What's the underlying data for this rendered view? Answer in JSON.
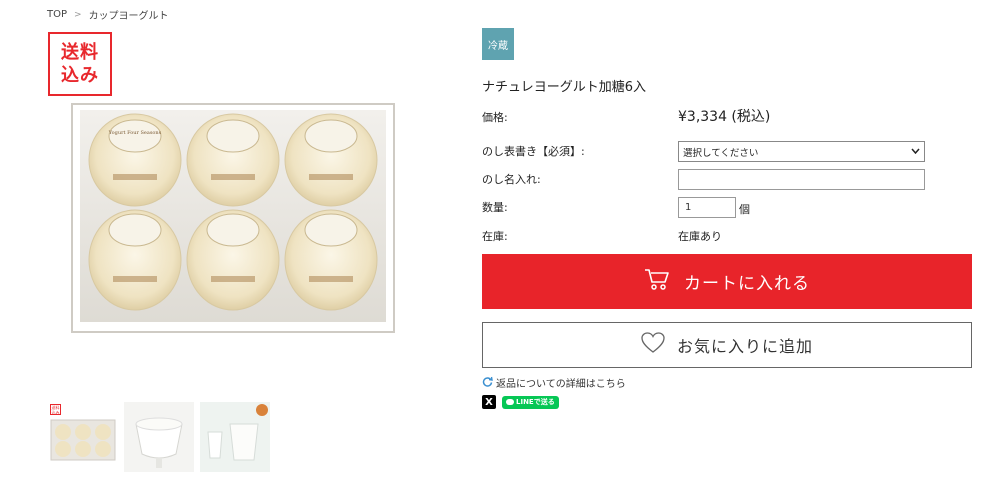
{
  "breadcrumb": {
    "home": "TOP",
    "separator": ">",
    "current": "カップヨーグルト"
  },
  "badges": {
    "free_shipping_line1": "送料",
    "free_shipping_line2": "込み",
    "chilled": "冷蔵"
  },
  "product": {
    "name": "ナチュレヨーグルト加糖6入",
    "price_label": "価格:",
    "price": "¥3,334 (税込)",
    "noshi_label": "のし表書き【必須】:",
    "noshi_selected": "選択してください",
    "noshi_name_label": "のし名入れ:",
    "noshi_name_value": "",
    "quantity_label": "数量:",
    "quantity_value": "1",
    "quantity_unit": "個",
    "stock_label": "在庫:",
    "stock_value": "在庫あり",
    "cup_text": "Yogurt Four Seasons"
  },
  "actions": {
    "cart_label": "カートに入れる",
    "favorite_label": "お気に入りに追加",
    "return_link": "返品についての詳細はこちら",
    "x_label": "X",
    "line_label": "LINEで送る"
  },
  "colors": {
    "accent_red": "#e8242a",
    "chilled_badge": "#5fa3b0",
    "line_green": "#06c755"
  }
}
